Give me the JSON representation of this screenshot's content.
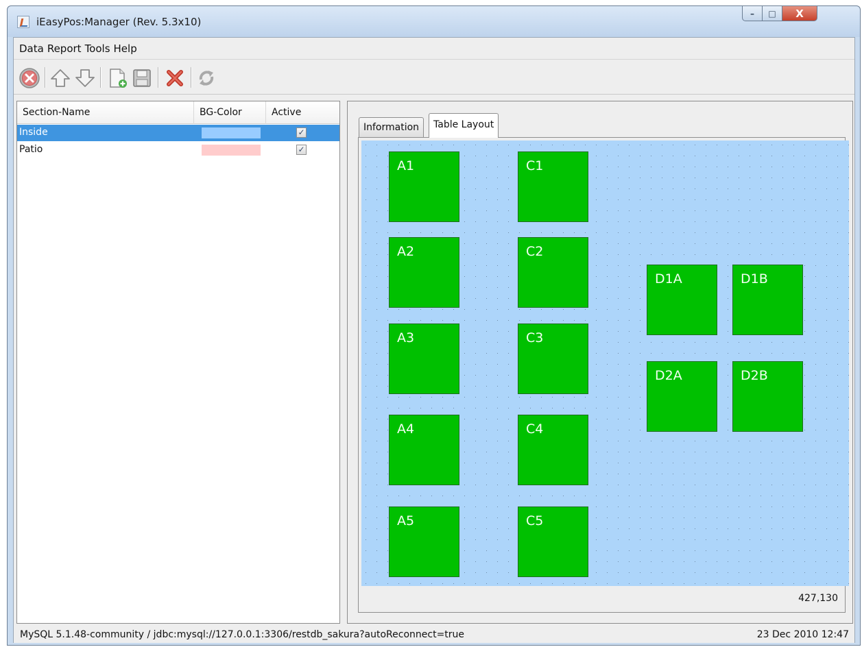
{
  "window": {
    "title": "iEasyPos:Manager (Rev. 5.3x10)",
    "controls": {
      "minimize": "–",
      "maximize": "□",
      "close": "X"
    }
  },
  "menu": [
    {
      "label": "Data"
    },
    {
      "label": "Report"
    },
    {
      "label": "Tools"
    },
    {
      "label": "Help"
    }
  ],
  "toolbar": [
    {
      "name": "cancel",
      "icon": "cancel-circle-icon"
    },
    {
      "name": "move-up",
      "icon": "arrow-up-icon"
    },
    {
      "name": "move-down",
      "icon": "arrow-down-icon"
    },
    {
      "name": "new",
      "icon": "new-document-icon"
    },
    {
      "name": "save",
      "icon": "floppy-disk-icon"
    },
    {
      "name": "delete",
      "icon": "red-x-icon"
    },
    {
      "name": "refresh",
      "icon": "refresh-icon"
    }
  ],
  "sections_table": {
    "columns": [
      "Section-Name",
      "BG-Color",
      "Active"
    ],
    "rows": [
      {
        "name": "Inside",
        "bg_color": "#99ccff",
        "active": true,
        "selected": true
      },
      {
        "name": "Patio",
        "bg_color": "#ffcccc",
        "active": true,
        "selected": false
      }
    ]
  },
  "tabs": {
    "information": "Information",
    "table_layout": "Table Layout",
    "selected": "Table Layout"
  },
  "layout": {
    "background_color": "#add5fa",
    "table_color": "#00c000",
    "tables": [
      {
        "label": "A1"
      },
      {
        "label": "A2"
      },
      {
        "label": "A3"
      },
      {
        "label": "A4"
      },
      {
        "label": "A5"
      },
      {
        "label": "C1"
      },
      {
        "label": "C2"
      },
      {
        "label": "C3"
      },
      {
        "label": "C4"
      },
      {
        "label": "C5"
      },
      {
        "label": "D1A"
      },
      {
        "label": "D1B"
      },
      {
        "label": "D2A"
      },
      {
        "label": "D2B"
      }
    ],
    "coordinates": "427,130"
  },
  "status": {
    "connection": "MySQL 5.1.48-community / jdbc:mysql://127.0.0.1:3306/restdb_sakura?autoReconnect=true",
    "datetime": "23 Dec 2010 12:47"
  }
}
